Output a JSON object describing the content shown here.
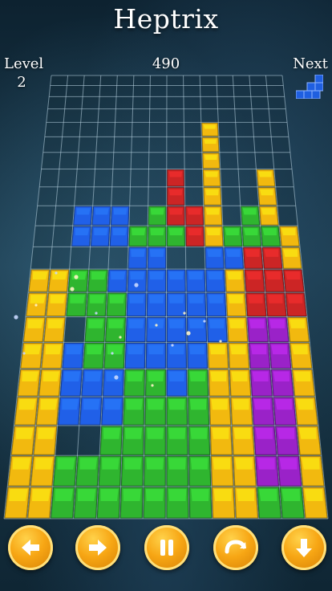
{
  "header": {
    "title": "Heptrix"
  },
  "hud": {
    "level_label": "Level",
    "level_value": "2",
    "score": "490",
    "next_label": "Next"
  },
  "next_piece": {
    "color": "#1f5fe0"
  },
  "colors": {
    "Y": "#f2b90f",
    "G": "#2fb52f",
    "B": "#2060e8",
    "R": "#cc2525",
    "P": "#9a22c8"
  },
  "board": {
    "cols": 14,
    "rows": 21,
    "cells": [
      ".........Y....",
      ".........Y....",
      ".........Y....",
      ".......R.Y..Y.",
      ".......R.Y..Y.",
      "..BBB.GRRY.GY.",
      "..BBBGGGRYGGGY",
      ".....BB..BBRRY",
      "YYGGBBBBBBYRRR",
      "YYGGGBBBBBYRRR",
      "YY.GGBBBBBYPPY",
      "YYBGGBBBBYYPPY",
      "YYBBBGGBGYYPPY",
      "YYBBBGGGGYYPPY",
      "YY..GGGGGYYPPY",
      "YYGGGGGGGYYPPY",
      "YYGGGGGGGYYGGY"
    ]
  },
  "controls": [
    {
      "name": "move-left-button",
      "icon": "arrow-left-icon"
    },
    {
      "name": "move-right-button",
      "icon": "arrow-right-icon"
    },
    {
      "name": "pause-button",
      "icon": "pause-icon"
    },
    {
      "name": "rotate-button",
      "icon": "rotate-icon"
    },
    {
      "name": "drop-button",
      "icon": "arrow-down-icon"
    }
  ]
}
